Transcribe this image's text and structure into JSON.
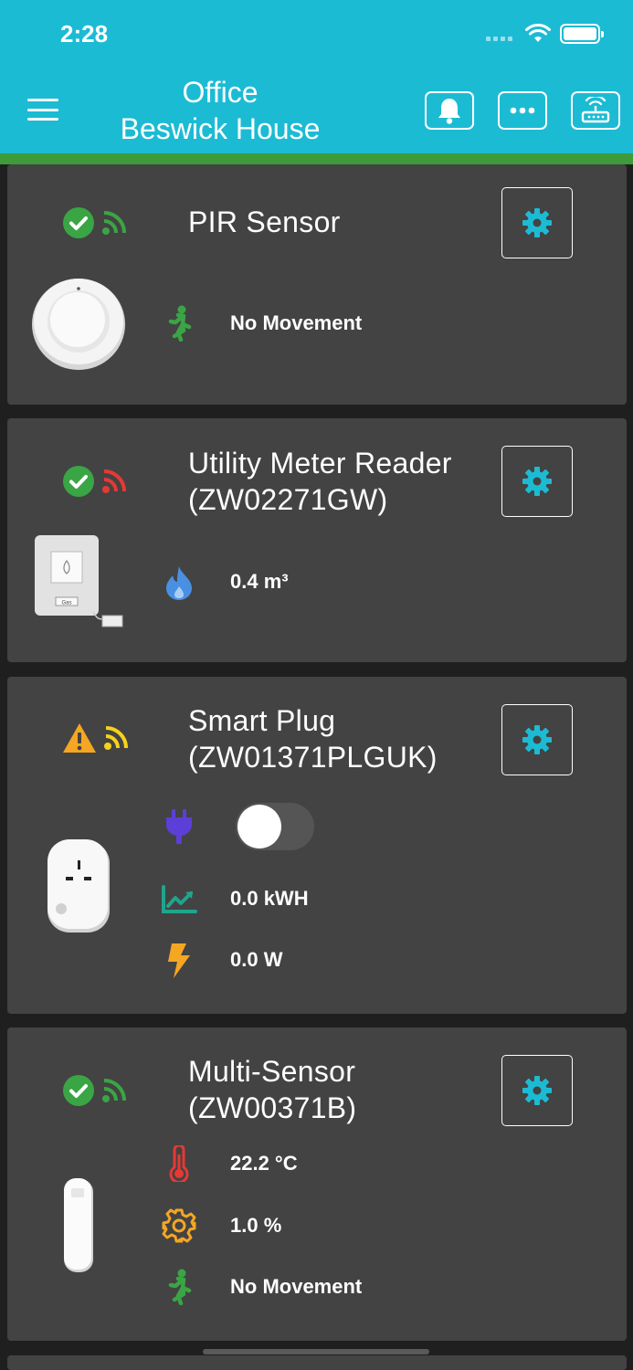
{
  "status_bar": {
    "time": "2:28"
  },
  "header": {
    "title_line1": "Office",
    "title_line2": "Beswick House",
    "buttons": [
      "bell-icon",
      "more-icon",
      "hub-icon"
    ]
  },
  "colors": {
    "header_bg": "#1cbbd4",
    "accent_bar": "#3f9a3a",
    "card_bg": "#434343",
    "ok_green": "#3aa544",
    "warn_orange": "#f5a623",
    "signal_red": "#e53935",
    "signal_yellow": "#f6d21c",
    "gear_blue": "#1cbbd4"
  },
  "devices": [
    {
      "name": "PIR Sensor",
      "status": "ok",
      "signal": "green",
      "readings": [
        {
          "icon": "walking-icon",
          "value": "No Movement"
        }
      ]
    },
    {
      "name": "Utility Meter Reader (ZW02271GW)",
      "name_line1": "Utility Meter Reader",
      "name_line2": "(ZW02271GW)",
      "status": "ok",
      "signal": "red",
      "image_label": "Gas",
      "readings": [
        {
          "icon": "flame-icon",
          "value": "0.4 m³"
        }
      ]
    },
    {
      "name": "Smart Plug (ZW01371PLGUK)",
      "name_line1": "Smart Plug",
      "name_line2": "(ZW01371PLGUK)",
      "status": "warning",
      "signal": "yellow",
      "power_toggle": "off",
      "readings": [
        {
          "icon": "chart-icon",
          "value": "0.0 kWH"
        },
        {
          "icon": "bolt-icon",
          "value": "0.0 W"
        }
      ]
    },
    {
      "name": "Multi-Sensor (ZW00371B)",
      "name_line1": "Multi-Sensor",
      "name_line2": "(ZW00371B)",
      "status": "ok",
      "signal": "green",
      "readings": [
        {
          "icon": "thermometer-icon",
          "value": "22.2 °C"
        },
        {
          "icon": "gear-icon",
          "value": "1.0 %"
        },
        {
          "icon": "walking-icon",
          "value": "No Movement"
        }
      ]
    }
  ]
}
